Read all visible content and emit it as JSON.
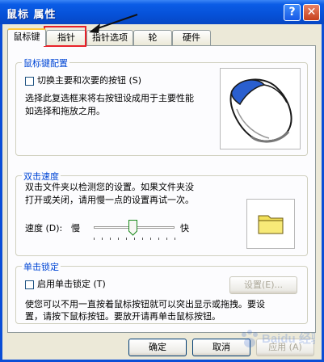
{
  "window": {
    "title": "鼠标 属性",
    "help_label": "?",
    "close_label": "✕"
  },
  "tabs": [
    {
      "label": "鼠标键",
      "active": true
    },
    {
      "label": "指针",
      "active": false
    },
    {
      "label": "指针选项",
      "active": false
    },
    {
      "label": "轮",
      "active": false
    },
    {
      "label": "硬件",
      "active": false
    }
  ],
  "button_config": {
    "title": "鼠标键配置",
    "switch_label": "切换主要和次要的按钮 (S)",
    "description_1": "选择此复选框来将右按钮设成用于主要性能",
    "description_2": "如选择和拖放之用。"
  },
  "double_click": {
    "title": "双击速度",
    "description_1": "双击文件夹以检测您的设置。如果文件夹没",
    "description_2": "打开或关闭，请用慢一点的设置再试一次。",
    "speed_label": "速度 (D):",
    "slow_label": "慢",
    "fast_label": "快",
    "speed_value": 0.48
  },
  "click_lock": {
    "title": "单击锁定",
    "enable_label": "启用单击锁定 (T)",
    "settings_label": "设置(E)...",
    "description_1": "使您可以不用一直按着鼠标按钮就可以突出显示或拖拽。要设",
    "description_2": "置，请按下鼠标按钮。要放开请再单击鼠标按钮。"
  },
  "footer": {
    "ok_label": "确定",
    "cancel_label": "取消",
    "apply_label": "应用 (A)"
  },
  "watermark": "Baidu 经验"
}
